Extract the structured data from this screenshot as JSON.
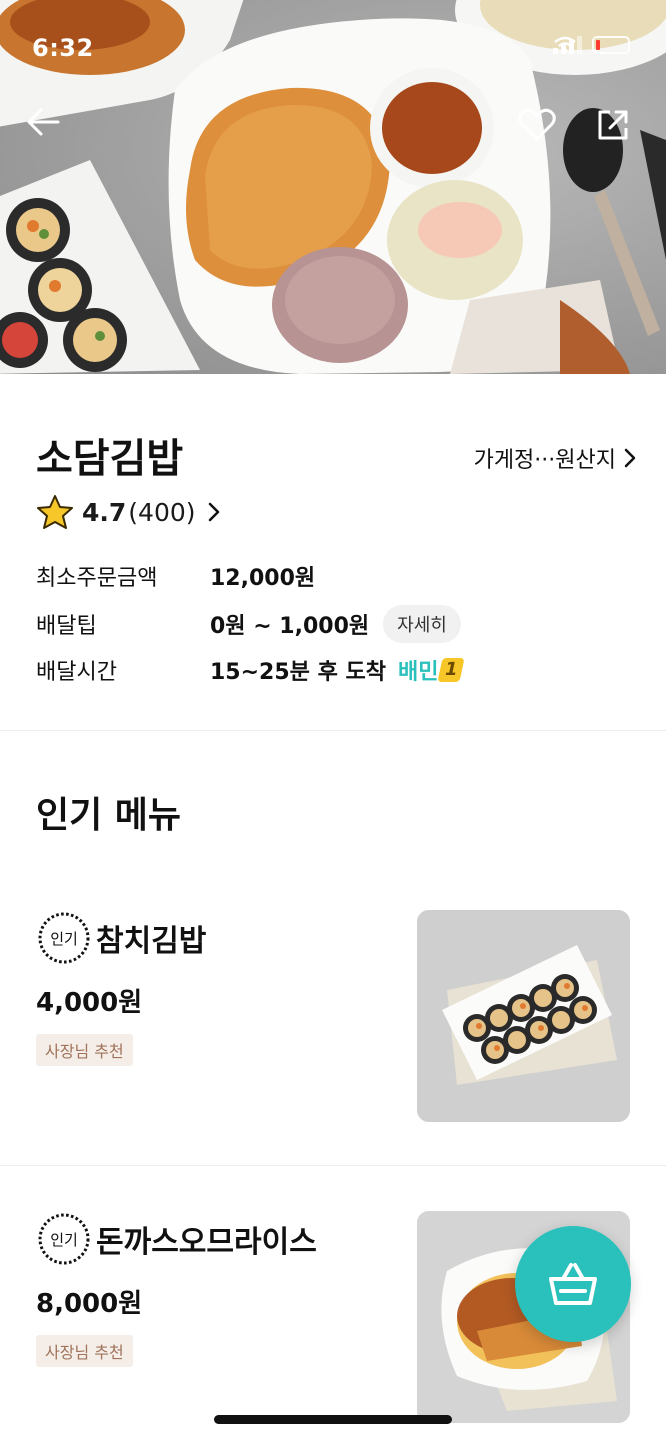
{
  "status_bar": {
    "time": "6:32"
  },
  "store": {
    "name": "소담김밥",
    "info_link": "가게정···원산지",
    "rating": "4.7",
    "review_count": "(400)"
  },
  "delivery_info": [
    {
      "label": "최소주문금액",
      "value": "12,000원"
    },
    {
      "label": "배달팁",
      "value": "0원 ~ 1,000원",
      "action": "자세히"
    },
    {
      "label": "배달시간",
      "value": "15~25분 후 도착",
      "badge": "배민",
      "badge_suffix": "1"
    }
  ],
  "popular_menu": {
    "title": "인기 메뉴",
    "badge": "인기",
    "items": [
      {
        "name": "참치김밥",
        "price": "4,000원",
        "tag": "사장님 추천"
      },
      {
        "name": "돈까스오므라이스",
        "price": "8,000원",
        "tag": "사장님 추천"
      }
    ]
  },
  "colors": {
    "brand": "#2ac1bc",
    "owner_tag_bg": "#f5eee8",
    "owner_tag_text": "#a0735a"
  }
}
